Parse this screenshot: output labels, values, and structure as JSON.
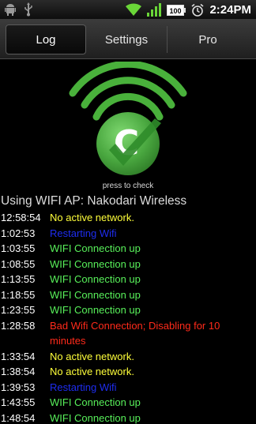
{
  "statusbar": {
    "time": "2:24PM",
    "battery_label": "100",
    "icons": [
      "android-debug-icon",
      "usb-icon",
      "wifi-signal-icon",
      "cell-signal-icon",
      "battery-icon",
      "alarm-icon"
    ]
  },
  "tabs": [
    {
      "label": "Log",
      "active": true
    },
    {
      "label": "Settings",
      "active": false
    },
    {
      "label": "Pro",
      "active": false
    }
  ],
  "hero": {
    "icon": "wifi-check-logo",
    "letter": "C",
    "press_hint": "press to check"
  },
  "access_point": "Using WIFI AP: Nakodari Wireless",
  "colors": {
    "yellow": "#ffff3a",
    "blue": "#1e2df0",
    "green": "#58f05a",
    "red": "#ff2a1a",
    "logo_green": "#49b13b"
  },
  "log": [
    {
      "time": "12:58:54",
      "message": "No active network.",
      "color": "#ffff3a"
    },
    {
      "time": "1:02:53",
      "message": "Restarting Wifi",
      "color": "#1e2df0"
    },
    {
      "time": "1:03:55",
      "message": "WIFI Connection up",
      "color": "#58f05a"
    },
    {
      "time": "1:08:55",
      "message": "WIFI Connection up",
      "color": "#58f05a"
    },
    {
      "time": "1:13:55",
      "message": "WIFI Connection up",
      "color": "#58f05a"
    },
    {
      "time": "1:18:55",
      "message": "WIFI Connection up",
      "color": "#58f05a"
    },
    {
      "time": "1:23:55",
      "message": "WIFI Connection up",
      "color": "#58f05a"
    },
    {
      "time": "1:28:58",
      "message": "Bad Wifi Connection; Disabling for 10 minutes",
      "color": "#ff2a1a"
    },
    {
      "time": "1:33:54",
      "message": "No active network.",
      "color": "#ffff3a"
    },
    {
      "time": "1:38:54",
      "message": "No active network.",
      "color": "#ffff3a"
    },
    {
      "time": "1:39:53",
      "message": "Restarting Wifi",
      "color": "#1e2df0"
    },
    {
      "time": "1:43:55",
      "message": "WIFI Connection up",
      "color": "#58f05a"
    },
    {
      "time": "1:48:54",
      "message": "WIFI Connection up",
      "color": "#58f05a"
    }
  ]
}
